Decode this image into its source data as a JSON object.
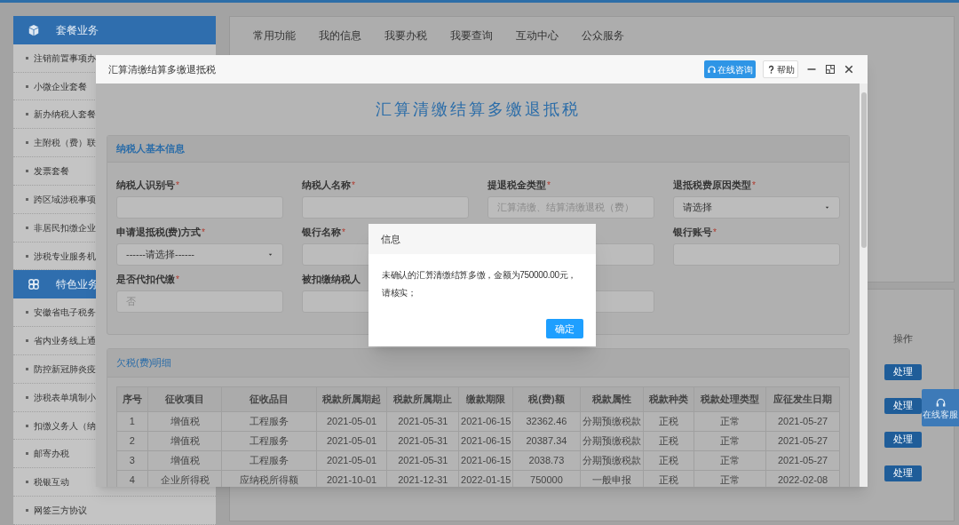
{
  "sidebar": {
    "sections": [
      {
        "title": "套餐业务",
        "items": [
          "注销前置事项办",
          "小微企业套餐",
          "新办纳税人套餐",
          "主附税（费）联",
          "发票套餐",
          "跨区域涉税事项",
          "非居民扣缴企业",
          "涉税专业服务机"
        ]
      },
      {
        "title": "特色业务",
        "items": [
          "安徽省电子税务",
          "省内业务线上通",
          "防控新冠肺炎疫",
          "涉税表单填制小",
          "扣缴义务人（纳",
          "邮寄办税",
          "税银互动",
          "网签三方协议"
        ]
      }
    ]
  },
  "nav_tabs": [
    "常用功能",
    "我的信息",
    "我要办税",
    "我要查询",
    "互动中心",
    "公众服务"
  ],
  "operations": {
    "header": "操作",
    "buttons": [
      "处理",
      "处理",
      "处理",
      "处理"
    ]
  },
  "float_button": {
    "label": "在线客服"
  },
  "modal": {
    "title": "汇算清缴结算多缴退抵税",
    "consult_button": "在线咨询",
    "help_button": "帮助",
    "heading": "汇算清缴结算多缴退抵税",
    "basic_info": {
      "title": "纳税人基本信息",
      "fields": [
        {
          "label": "纳税人识别号",
          "mark": "*",
          "kind": "input"
        },
        {
          "label": "纳税人名称",
          "mark": "*",
          "kind": "input"
        },
        {
          "label": "提退税金类型",
          "mark": "*",
          "kind": "input",
          "disabled": true,
          "value": "汇算清缴、结算清缴退税（费）"
        },
        {
          "label": "退抵税费原因类型",
          "mark": "*",
          "kind": "select",
          "disabled": false,
          "value": "请选择"
        },
        {
          "label": "申请退抵税(费)方式",
          "mark": "*",
          "kind": "select",
          "disabled": false,
          "value": "------请选择------"
        },
        {
          "label": "银行名称",
          "mark": "*",
          "kind": "input"
        },
        {
          "kind": "input"
        },
        {
          "label": "银行账号",
          "mark": "*",
          "kind": "input"
        },
        {
          "label": "是否代扣代缴",
          "mark": "*",
          "kind": "input",
          "disabled": true,
          "value": "否"
        },
        {
          "label": "被扣缴纳税人",
          "kind": "input"
        },
        {
          "kind": "input"
        }
      ]
    },
    "arrears": {
      "title": "欠税(费)明细",
      "columns": [
        "序号",
        "征收项目",
        "征收品目",
        "税款所属期起",
        "税款所属期止",
        "缴款期限",
        "税(费)额",
        "税款属性",
        "税款种类",
        "税款处理类型",
        "应征发生日期"
      ],
      "rows": [
        [
          "1",
          "增值税",
          "工程服务",
          "2021-05-01",
          "2021-05-31",
          "2021-06-15",
          "32362.46",
          "分期预缴税款",
          "正税",
          "正常",
          "2021-05-27"
        ],
        [
          "2",
          "增值税",
          "工程服务",
          "2021-05-01",
          "2021-05-31",
          "2021-06-15",
          "20387.34",
          "分期预缴税款",
          "正税",
          "正常",
          "2021-05-27"
        ],
        [
          "3",
          "增值税",
          "工程服务",
          "2021-05-01",
          "2021-05-31",
          "2021-06-15",
          "2038.73",
          "分期预缴税款",
          "正税",
          "正常",
          "2021-05-27"
        ],
        [
          "4",
          "企业所得税",
          "应纳税所得额",
          "2021-10-01",
          "2021-12-31",
          "2022-01-15",
          "750000",
          "一般申报",
          "正税",
          "正常",
          "2022-02-08"
        ]
      ]
    }
  },
  "dialog": {
    "title": "信息",
    "message": "未确认的汇算清缴结算多缴，金额为750000.00元，请核实；",
    "button": "确定"
  }
}
